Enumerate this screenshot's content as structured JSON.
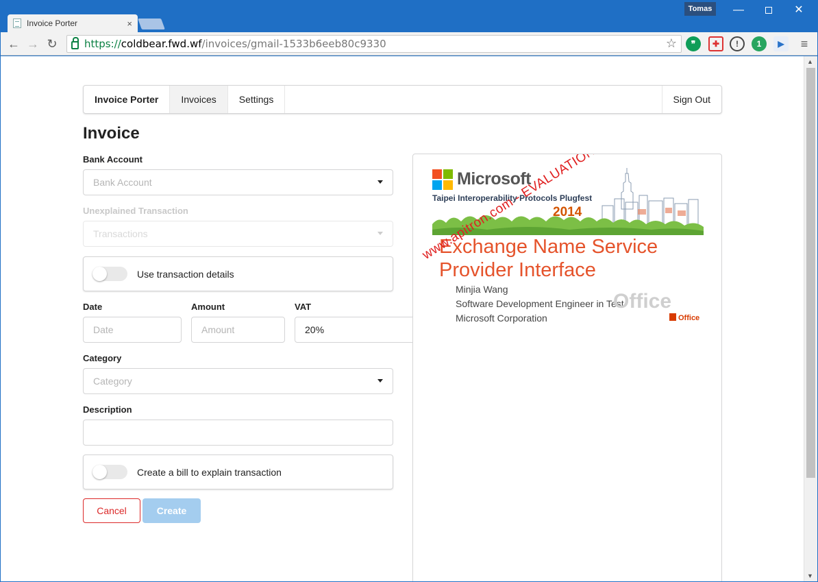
{
  "browser": {
    "tab_title": "Invoice Porter",
    "tab_close": "×",
    "profile_name": "Tomas",
    "url_scheme": "https://",
    "url_host": "coldbear.fwd.wf",
    "url_path": "/invoices/gmail-1533b6eeb80c9330",
    "back_glyph": "←",
    "forward_glyph": "→",
    "reload_glyph": "↻",
    "star_glyph": "☆",
    "menu_glyph": "≡",
    "minimize_glyph": "—",
    "close_glyph": "✕",
    "extensions": {
      "hangouts": "❞",
      "plus": "✚",
      "info": "!",
      "vpn": "1",
      "play": "▶"
    },
    "scroll_up": "▲",
    "scroll_down": "▼"
  },
  "nav": {
    "brand": "Invoice Porter",
    "items": [
      {
        "label": "Invoices",
        "active": true
      },
      {
        "label": "Settings",
        "active": false
      }
    ],
    "sign_out": "Sign Out"
  },
  "page": {
    "title": "Invoice"
  },
  "form": {
    "bank_account": {
      "label": "Bank Account",
      "placeholder": "Bank Account"
    },
    "transaction": {
      "label": "Unexplained Transaction",
      "placeholder": "Transactions",
      "disabled": true
    },
    "use_details": {
      "label": "Use transaction details",
      "on": false
    },
    "date": {
      "label": "Date",
      "placeholder": "Date"
    },
    "amount": {
      "label": "Amount",
      "placeholder": "Amount"
    },
    "vat": {
      "label": "VAT",
      "value": "20%"
    },
    "category": {
      "label": "Category",
      "placeholder": "Category"
    },
    "description": {
      "label": "Description",
      "value": ""
    },
    "create_bill": {
      "label": "Create a bill to explain transaction",
      "on": false
    },
    "cancel_label": "Cancel",
    "create_label": "Create"
  },
  "preview": {
    "brand": "Microsoft",
    "event": "Taipei Interoperability Protocols Plugfest",
    "year": "2014",
    "title_line1": "Exchange Name Service",
    "title_line2": "Provider Interface",
    "speaker": "Minjia Wang",
    "role": "Software Development Engineer in Test",
    "company": "Microsoft Corporation",
    "office_mark": "Office",
    "office_small": "Office",
    "watermark": "www.apitron.com - EVALUATION version *www."
  },
  "colors": {
    "chrome_blue": "#1f6fc5",
    "cancel_red": "#db2828",
    "create_blue": "#a4cdef",
    "slide_orange": "#e5532b",
    "watermark_red": "#e02020"
  }
}
